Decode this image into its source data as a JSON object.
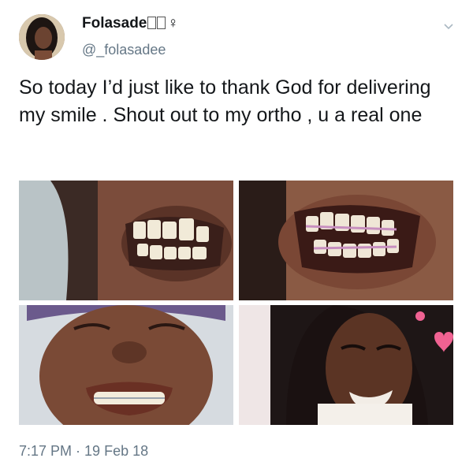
{
  "author": {
    "display_name": "Folasade",
    "display_name_suffix": "♀",
    "handle": "@_folasadee"
  },
  "tweet": {
    "text": "So today I’d just like to thank God for delivering my smile . Shout out to my ortho , u a real one",
    "time": "7:17 PM",
    "separator": " · ",
    "date": "19 Feb 18"
  },
  "icons": {
    "menu": "chevron-down-icon"
  },
  "colors": {
    "text": "#14171a",
    "secondary": "#657786"
  }
}
